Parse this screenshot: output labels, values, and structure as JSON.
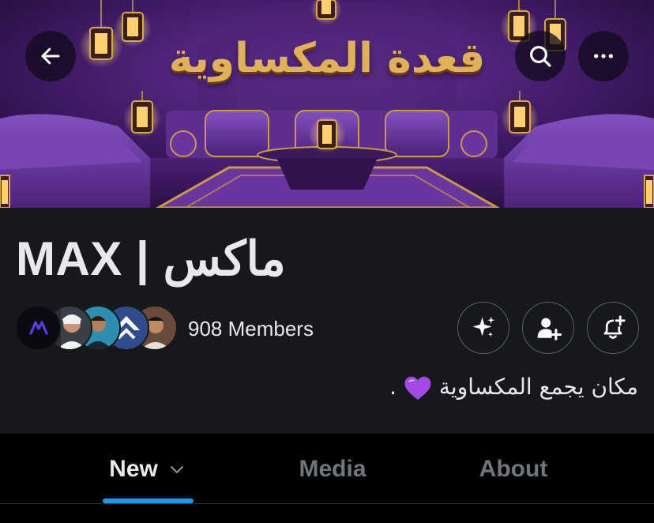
{
  "banner": {
    "title": "قعدة المكساوية",
    "colors": {
      "purple_dark": "#2a1140",
      "purple": "#5a2a86",
      "gold": "#e0b15a"
    }
  },
  "nav": {
    "back_icon": "arrow-left-icon",
    "search_icon": "search-icon",
    "more_icon": "more-horizontal-icon"
  },
  "community": {
    "name": "MAX | ماكس",
    "members_label": "908 Members",
    "description": "مكان يجمع المكساوية",
    "description_suffix": ".",
    "description_emoji": "purple-heart-icon"
  },
  "actions": {
    "sparkle_icon": "sparkle-icon",
    "add_user_icon": "add-user-icon",
    "bell_icon": "bell-plus-icon"
  },
  "tabs": [
    {
      "label": "New",
      "active": true
    },
    {
      "label": "Media",
      "active": false
    },
    {
      "label": "About",
      "active": false
    }
  ],
  "colors": {
    "accent": "#1d9bf0",
    "background": "#16181c",
    "text": "#e7e9ea",
    "muted": "#71767b"
  }
}
